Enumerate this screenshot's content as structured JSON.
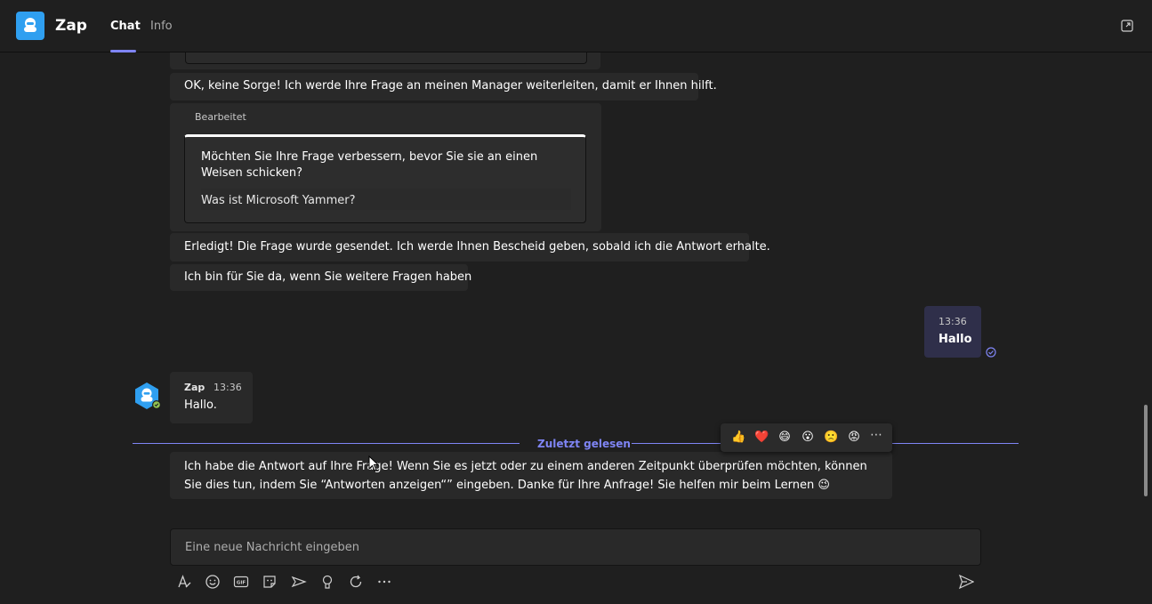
{
  "header": {
    "app_title": "Zap",
    "tabs": [
      {
        "label": "Chat",
        "active": true
      },
      {
        "label": "Info",
        "active": false
      }
    ]
  },
  "messages": {
    "m1": "OK, keine Sorge! Ich werde Ihre Frage an meinen Manager weiterleiten, damit er Ihnen hilft.",
    "edited_card": {
      "edited_label": "Bearbeitet",
      "question": "Möchten Sie Ihre Frage verbessern, bevor Sie sie an einen Weisen schicken?",
      "answer": "Was ist Microsoft Yammer?"
    },
    "m2": "Erledigt! Die Frage wurde gesendet. Ich werde Ihnen Bescheid geben, sobald ich die Antwort erhalte.",
    "m3": "Ich bin für Sie da, wenn Sie weitere Fragen haben",
    "self": {
      "time": "13:36",
      "text": "Hallo"
    },
    "bot": {
      "name": "Zap",
      "time": "13:36",
      "text": "Hallo."
    },
    "last_read_label": "Zuletzt gelesen",
    "long": "Ich habe die Antwort auf Ihre Frage! Wenn Sie es jetzt oder zu einem anderen Zeitpunkt überprüfen möchten, können Sie dies tun, indem Sie “Antworten anzeigen“” eingeben. Danke für Ihre Anfrage! Sie helfen mir beim Lernen 😉"
  },
  "reactions": [
    {
      "name": "like",
      "glyph": "👍"
    },
    {
      "name": "heart",
      "glyph": "❤️"
    },
    {
      "name": "laugh",
      "glyph": "😄"
    },
    {
      "name": "surprised",
      "glyph": "😮"
    },
    {
      "name": "sad",
      "glyph": "🙁"
    },
    {
      "name": "angry",
      "glyph": "😡"
    }
  ],
  "composer": {
    "placeholder": "Eine neue Nachricht eingeben"
  },
  "colors": {
    "accent": "#7f85f5",
    "logo": "#2f9ff0",
    "self_bubble": "#2f2f4a",
    "bubble": "#292929"
  }
}
